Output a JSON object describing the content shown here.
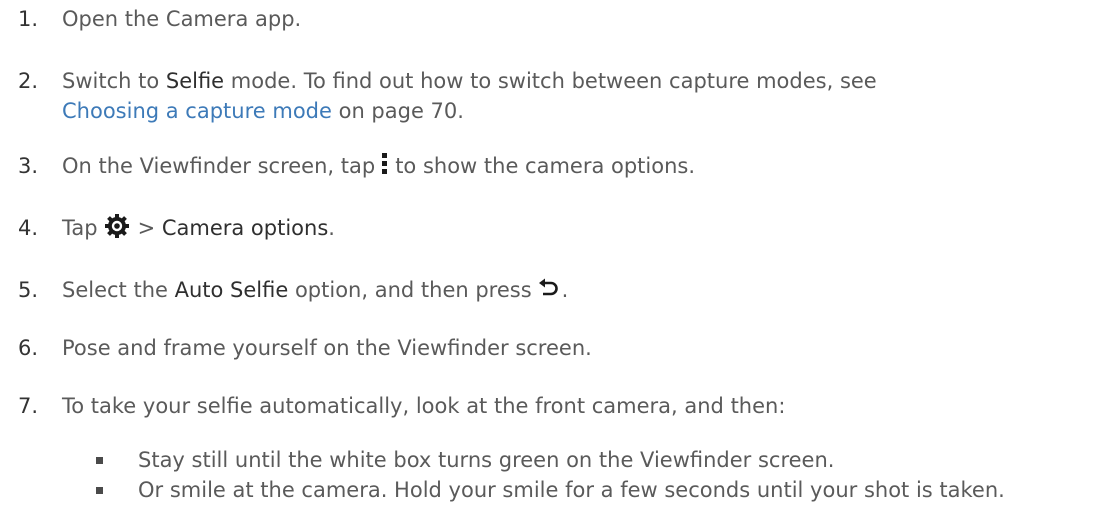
{
  "steps": [
    {
      "number": "1.",
      "text": "Open the Camera app."
    },
    {
      "number": "2.",
      "pre": "Switch to ",
      "bold": "Selfie",
      "post": " mode. To find out how to switch between capture modes, see",
      "link": "Choosing a capture mode",
      "tail": " on page 70."
    },
    {
      "number": "3.",
      "pre": "On the Viewfinder screen, tap",
      "icon": "more-vertical-icon",
      "post": "to show the camera options."
    },
    {
      "number": "4.",
      "pre": "Tap",
      "icon": "gear-icon",
      "sep": "> ",
      "bold": "Camera options",
      "post": "."
    },
    {
      "number": "5.",
      "pre": "Select the ",
      "bold": "Auto Selfie",
      "post": " option, and then press",
      "icon": "back-icon",
      "tail": "."
    },
    {
      "number": "6.",
      "text": "Pose and frame yourself on the Viewfinder screen."
    },
    {
      "number": "7.",
      "text": "To take your selfie automatically, look at the front camera, and then:"
    }
  ],
  "bullets": [
    "Stay still until the white box turns green on the Viewfinder screen.",
    "Or smile at the camera. Hold your smile for a few seconds until your shot is taken."
  ],
  "colors": {
    "text": "#5a5a5a",
    "emphasis": "#2f2f2f",
    "link": "#3d7ab8",
    "icon": "#1a1a1a"
  }
}
